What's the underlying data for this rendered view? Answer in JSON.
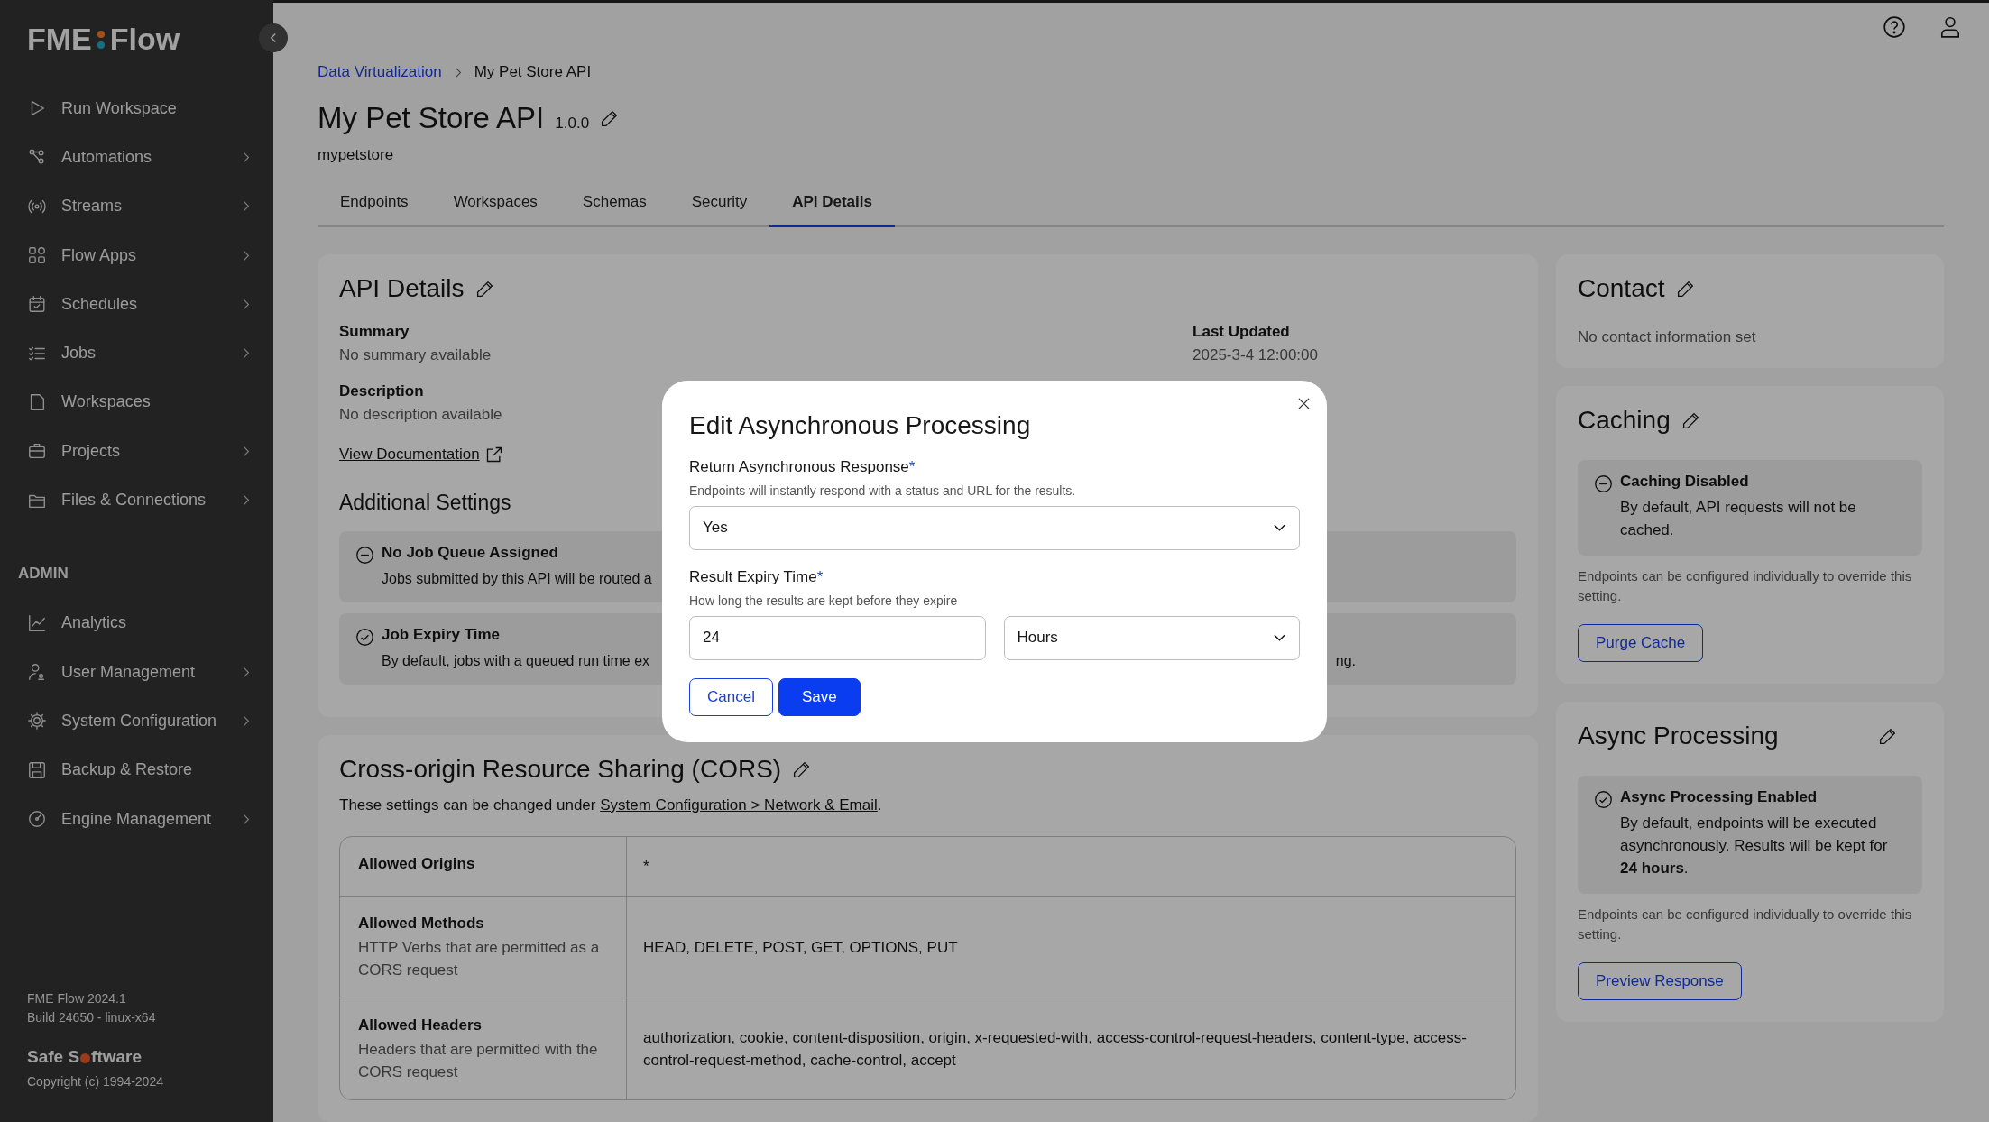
{
  "sidebar": {
    "logo": [
      "FME",
      "Flow"
    ],
    "nav": [
      {
        "label": "Run Workspace",
        "expandable": false
      },
      {
        "label": "Automations",
        "expandable": true
      },
      {
        "label": "Streams",
        "expandable": true
      },
      {
        "label": "Flow Apps",
        "expandable": true
      },
      {
        "label": "Schedules",
        "expandable": true
      },
      {
        "label": "Jobs",
        "expandable": true
      },
      {
        "label": "Workspaces",
        "expandable": false
      },
      {
        "label": "Projects",
        "expandable": true
      },
      {
        "label": "Files & Connections",
        "expandable": true
      }
    ],
    "admin": {
      "heading": "ADMIN",
      "items": [
        {
          "label": "Analytics",
          "expandable": false
        },
        {
          "label": "User Management",
          "expandable": true
        },
        {
          "label": "System Configuration",
          "expandable": true
        },
        {
          "label": "Backup & Restore",
          "expandable": false
        },
        {
          "label": "Engine Management",
          "expandable": true
        }
      ]
    },
    "version": "FME Flow 2024.1",
    "build": "Build 24650 - linux-x64",
    "brand": [
      "Safe S",
      "ftware"
    ],
    "copyright": "Copyright (c) 1994-2024"
  },
  "breadcrumb": [
    {
      "label": "Data Virtualization",
      "kind": "link"
    },
    {
      "label": "My Pet Store API",
      "kind": "current"
    }
  ],
  "title": "My Pet Store API",
  "version": "1.0.0",
  "subtitle": "mypetstore",
  "tabs": [
    {
      "label": "Endpoints",
      "selected": false
    },
    {
      "label": "Workspaces",
      "selected": false
    },
    {
      "label": "Schemas",
      "selected": false
    },
    {
      "label": "Security",
      "selected": false
    },
    {
      "label": "API Details",
      "selected": true
    }
  ],
  "api_details": {
    "title": "API Details",
    "fields": [
      {
        "label": "Summary",
        "value": "No summary available"
      },
      {
        "label": "Description",
        "value": "No description available"
      }
    ],
    "last_updated": {
      "label": "Last Updated",
      "value": "2025-3-4 12:00:00"
    },
    "link": "View Documentation",
    "settings_title": "Additional Settings",
    "settings": [
      {
        "kind": "disabled",
        "title": "No Job Queue Assigned",
        "text": "Jobs submitted by this API will be routed a"
      },
      {
        "kind": "enabled",
        "title": "Job Expiry Time",
        "text": "By default, jobs with a queued run time ex",
        "text_end": "ng."
      }
    ]
  },
  "cors": {
    "title": "Cross-origin Resource Sharing (CORS)",
    "note": "These settings can be changed under",
    "note_link": "System Configuration > Network & Email",
    "note_end": ".",
    "rows": [
      {
        "name": "Allowed Origins",
        "value": "*"
      },
      {
        "name": "Allowed Methods",
        "description": "HTTP Verbs that are permitted as a CORS request",
        "value": "HEAD, DELETE, POST, GET, OPTIONS, PUT"
      },
      {
        "name": "Allowed Headers",
        "description": "Headers that are permitted with the CORS request",
        "value": "authorization, cookie, content-disposition, origin, x-requested-with, access-control-request-headers, content-type, access-control-request-method, cache-control, accept"
      }
    ]
  },
  "contact": {
    "title": "Contact",
    "text": "No contact information set"
  },
  "caching": {
    "title": "Caching",
    "status": {
      "kind": "disabled",
      "title": "Caching Disabled",
      "text": "By default, API requests will not be cached."
    },
    "note": "Endpoints can be configured individually to override this setting.",
    "button": "Purge Cache"
  },
  "async": {
    "title": "Async Processing",
    "status": {
      "kind": "enabled",
      "title": "Async Processing Enabled",
      "text": "By default, endpoints will be executed asynchronously. Results will be kept for **24 hours**."
    },
    "note": "Endpoints can be configured individually to override this setting.",
    "button": "Preview Response"
  },
  "modal": {
    "title": "Edit Asynchronous Processing",
    "fields": [
      {
        "label": "Return Asynchronous Response",
        "required_mark": "*",
        "hint": "Endpoints will instantly respond with a status and URL for the results.",
        "controls": [
          {
            "kind": "select",
            "value": "Yes"
          }
        ]
      },
      {
        "label": "Result Expiry Time",
        "required_mark": "*",
        "hint": "How long the results are kept before they expire",
        "controls": [
          {
            "kind": "input",
            "value": "24"
          },
          {
            "kind": "select",
            "value": "Hours"
          }
        ]
      }
    ],
    "buttons": [
      {
        "label": "Cancel",
        "kind": "secondary"
      },
      {
        "label": "Save",
        "kind": "primary"
      }
    ]
  }
}
